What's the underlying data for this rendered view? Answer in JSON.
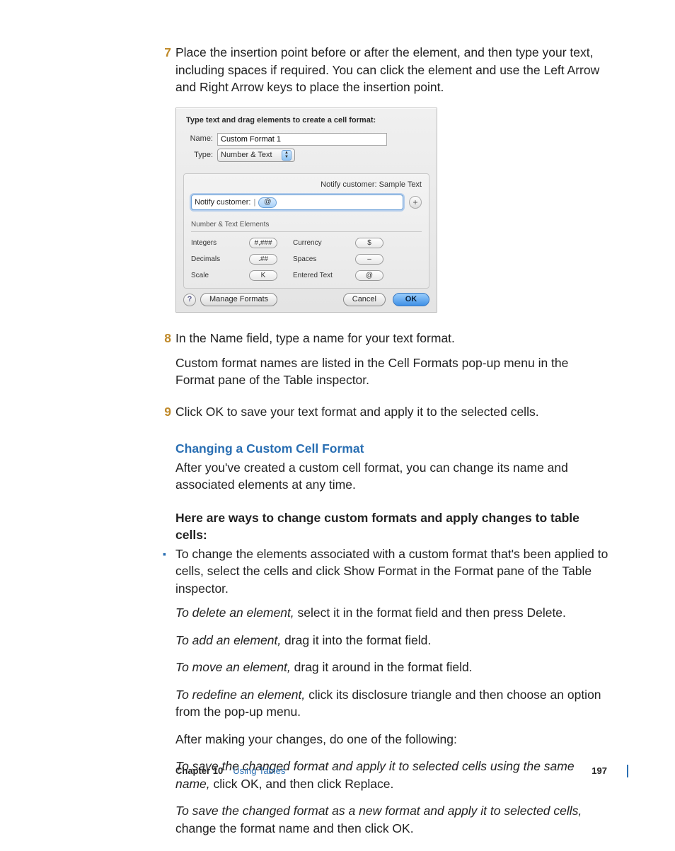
{
  "steps": {
    "s7": {
      "num": "7",
      "text": "Place the insertion point before or after the element, and then type your text, including spaces if required. You can click the element and use the Left Arrow and Right Arrow keys to place the insertion point."
    },
    "s8": {
      "num": "8",
      "line1": "In the Name field, type a name for your text format.",
      "line2": "Custom format names are listed in the Cell Formats pop-up menu in the Format pane of the Table inspector."
    },
    "s9": {
      "num": "9",
      "text": "Click OK to save your text format and apply it to the selected cells."
    }
  },
  "dialog": {
    "title": "Type text and drag elements to create a cell format:",
    "name_label": "Name:",
    "name_value": "Custom Format 1",
    "type_label": "Type:",
    "type_value": "Number & Text",
    "preview": "Notify customer: Sample Text",
    "format_prefix": "Notify customer:",
    "format_token": "@",
    "plus": "+",
    "elements_heading": "Number & Text Elements",
    "elements": {
      "integers_label": "Integers",
      "integers_token": "#,###",
      "currency_label": "Currency",
      "currency_token": "$",
      "decimals_label": "Decimals",
      "decimals_token": ".##",
      "spaces_label": "Spaces",
      "spaces_token": "–",
      "scale_label": "Scale",
      "scale_token": "K",
      "entered_label": "Entered Text",
      "entered_token": "@"
    },
    "help": "?",
    "manage": "Manage Formats",
    "cancel": "Cancel",
    "ok": "OK"
  },
  "section": {
    "heading": "Changing a Custom Cell Format",
    "intro": "After you've created a custom cell format, you can change its name and associated elements at any time.",
    "ways_heading": "Here are ways to change custom formats and apply changes to table cells:",
    "bullet1": "To change the elements associated with a custom format that's been applied to cells, select the cells and click Show Format in the Format pane of the Table inspector.",
    "delete_i": "To delete an element,",
    "delete_r": " select it in the format field and then press Delete.",
    "add_i": "To add an element,",
    "add_r": " drag it into the format field.",
    "move_i": "To move an element,",
    "move_r": " drag it around in the format field.",
    "redef_i": "To redefine an element,",
    "redef_r": " click its disclosure triangle and then choose an option from the pop-up menu.",
    "after": "After making your changes, do one of the following:",
    "save1_i": "To save the changed format and apply it to selected cells using the same name,",
    "save1_r": " click OK, and then click Replace.",
    "save2_i": "To save the changed format as a new format and apply it to selected cells,",
    "save2_r": " change the format name and then click OK."
  },
  "footer": {
    "chapter": "Chapter 10",
    "title": "Using Tables",
    "page": "197"
  }
}
